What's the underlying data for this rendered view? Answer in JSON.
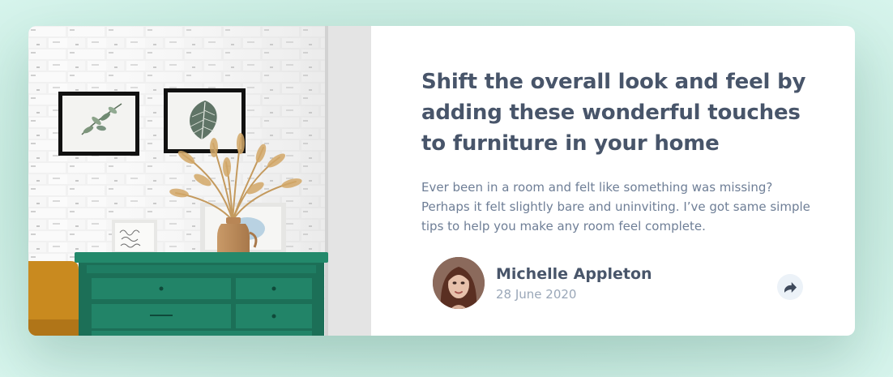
{
  "article": {
    "title": "Shift the overall look and feel by adding these wonderful touches to furniture in your home",
    "excerpt": "Ever been in a room and felt like something was missing? Perhaps it felt slightly bare and uninviting. I’ve got same simple tips to help you make any room feel complete.",
    "image_alt": "Green drawer cabinet with a vase of dried grass and framed botanical prints against a white brick wall"
  },
  "author": {
    "name": "Michelle Appleton",
    "date": "28 June 2020",
    "avatar_alt": "Michelle Appleton avatar"
  },
  "actions": {
    "share_icon": "share-arrow-icon"
  },
  "colors": {
    "background": "#c3e7dc",
    "heading": "#48556a",
    "body_text": "#6e7e96",
    "muted_text": "#9aa7b8",
    "share_button_bg": "#ecf2f8",
    "cabinet_green": "#1f7d63"
  }
}
